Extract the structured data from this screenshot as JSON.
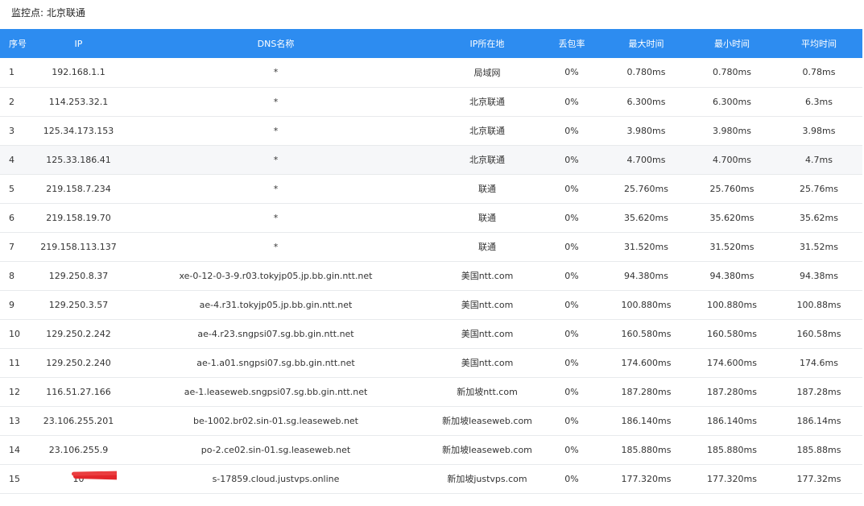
{
  "header": {
    "title": "监控点: 北京联通"
  },
  "table": {
    "columns": [
      "序号",
      "IP",
      "DNS名称",
      "IP所在地",
      "丢包率",
      "最大时间",
      "最小时间",
      "平均时间"
    ],
    "rows": [
      {
        "no": "1",
        "ip": "192.168.1.1",
        "dns": "*",
        "loc": "局域网",
        "loss": "0%",
        "max": "0.780ms",
        "min": "0.780ms",
        "avg": "0.78ms"
      },
      {
        "no": "2",
        "ip": "114.253.32.1",
        "dns": "*",
        "loc": "北京联通",
        "loss": "0%",
        "max": "6.300ms",
        "min": "6.300ms",
        "avg": "6.3ms"
      },
      {
        "no": "3",
        "ip": "125.34.173.153",
        "dns": "*",
        "loc": "北京联通",
        "loss": "0%",
        "max": "3.980ms",
        "min": "3.980ms",
        "avg": "3.98ms"
      },
      {
        "no": "4",
        "ip": "125.33.186.41",
        "dns": "*",
        "loc": "北京联通",
        "loss": "0%",
        "max": "4.700ms",
        "min": "4.700ms",
        "avg": "4.7ms"
      },
      {
        "no": "5",
        "ip": "219.158.7.234",
        "dns": "*",
        "loc": "联通",
        "loss": "0%",
        "max": "25.760ms",
        "min": "25.760ms",
        "avg": "25.76ms"
      },
      {
        "no": "6",
        "ip": "219.158.19.70",
        "dns": "*",
        "loc": "联通",
        "loss": "0%",
        "max": "35.620ms",
        "min": "35.620ms",
        "avg": "35.62ms"
      },
      {
        "no": "7",
        "ip": "219.158.113.137",
        "dns": "*",
        "loc": "联通",
        "loss": "0%",
        "max": "31.520ms",
        "min": "31.520ms",
        "avg": "31.52ms"
      },
      {
        "no": "8",
        "ip": "129.250.8.37",
        "dns": "xe-0-12-0-3-9.r03.tokyjp05.jp.bb.gin.ntt.net",
        "loc": "美国ntt.com",
        "loss": "0%",
        "max": "94.380ms",
        "min": "94.380ms",
        "avg": "94.38ms"
      },
      {
        "no": "9",
        "ip": "129.250.3.57",
        "dns": "ae-4.r31.tokyjp05.jp.bb.gin.ntt.net",
        "loc": "美国ntt.com",
        "loss": "0%",
        "max": "100.880ms",
        "min": "100.880ms",
        "avg": "100.88ms"
      },
      {
        "no": "10",
        "ip": "129.250.2.242",
        "dns": "ae-4.r23.sngpsi07.sg.bb.gin.ntt.net",
        "loc": "美国ntt.com",
        "loss": "0%",
        "max": "160.580ms",
        "min": "160.580ms",
        "avg": "160.58ms"
      },
      {
        "no": "11",
        "ip": "129.250.2.240",
        "dns": "ae-1.a01.sngpsi07.sg.bb.gin.ntt.net",
        "loc": "美国ntt.com",
        "loss": "0%",
        "max": "174.600ms",
        "min": "174.600ms",
        "avg": "174.6ms"
      },
      {
        "no": "12",
        "ip": "116.51.27.166",
        "dns": "ae-1.leaseweb.sngpsi07.sg.bb.gin.ntt.net",
        "loc": "新加坡ntt.com",
        "loss": "0%",
        "max": "187.280ms",
        "min": "187.280ms",
        "avg": "187.28ms"
      },
      {
        "no": "13",
        "ip": "23.106.255.201",
        "dns": "be-1002.br02.sin-01.sg.leaseweb.net",
        "loc": "新加坡leaseweb.com",
        "loss": "0%",
        "max": "186.140ms",
        "min": "186.140ms",
        "avg": "186.14ms"
      },
      {
        "no": "14",
        "ip": "23.106.255.9",
        "dns": "po-2.ce02.sin-01.sg.leaseweb.net",
        "loc": "新加坡leaseweb.com",
        "loss": "0%",
        "max": "185.880ms",
        "min": "185.880ms",
        "avg": "185.88ms"
      },
      {
        "no": "15",
        "ip": "10",
        "dns": "s-17859.cloud.justvps.online",
        "loc": "新加坡justvps.com",
        "loss": "0%",
        "max": "177.320ms",
        "min": "177.320ms",
        "avg": "177.32ms"
      }
    ]
  },
  "colors": {
    "header_bg": "#2d8cf0",
    "redaction": "#e3262b",
    "highlight_row": "#f6f7f9"
  }
}
